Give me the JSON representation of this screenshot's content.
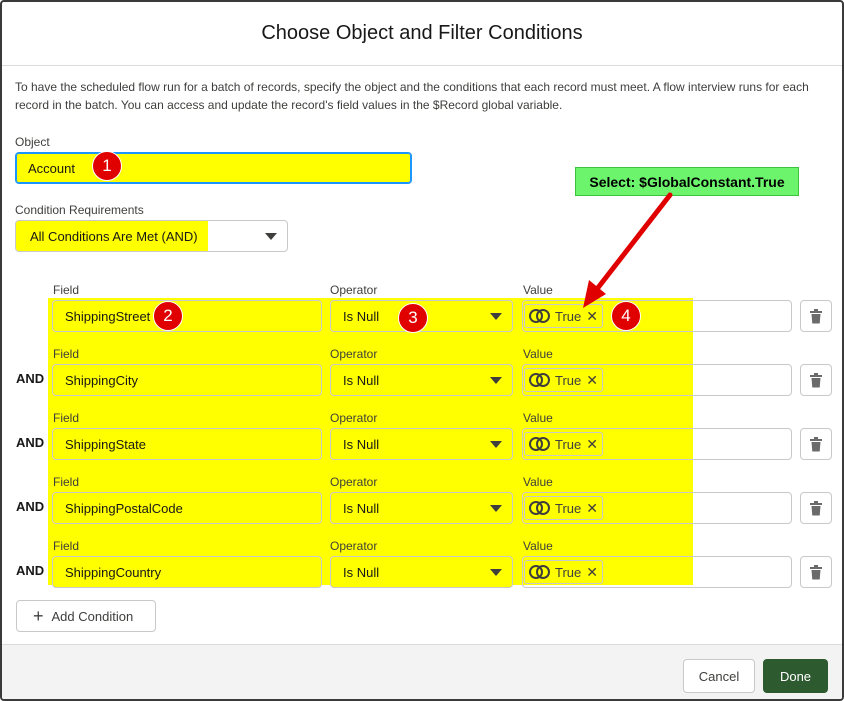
{
  "dialog": {
    "title": "Choose Object and Filter Conditions",
    "description": "To have the scheduled flow run for a batch of records, specify the object and the conditions that each record must meet. A flow interview runs for each record in the batch. You can access and update the record's field values in the $Record global variable."
  },
  "object": {
    "label": "Object",
    "value": "Account"
  },
  "requirements": {
    "label": "Condition Requirements",
    "value": "All Conditions Are Met (AND)"
  },
  "conditions": [
    {
      "connector": "",
      "field_label": "Field",
      "field": "ShippingStreet",
      "operator_label": "Operator",
      "operator": "Is Null",
      "value_label": "Value",
      "value": "True"
    },
    {
      "connector": "AND",
      "field_label": "Field",
      "field": "ShippingCity",
      "operator_label": "Operator",
      "operator": "Is Null",
      "value_label": "Value",
      "value": "True"
    },
    {
      "connector": "AND",
      "field_label": "Field",
      "field": "ShippingState",
      "operator_label": "Operator",
      "operator": "Is Null",
      "value_label": "Value",
      "value": "True"
    },
    {
      "connector": "AND",
      "field_label": "Field",
      "field": "ShippingPostalCode",
      "operator_label": "Operator",
      "operator": "Is Null",
      "value_label": "Value",
      "value": "True"
    },
    {
      "connector": "AND",
      "field_label": "Field",
      "field": "ShippingCountry",
      "operator_label": "Operator",
      "operator": "Is Null",
      "value_label": "Value",
      "value": "True"
    }
  ],
  "add_condition_label": "Add Condition",
  "footer": {
    "cancel_label": "Cancel",
    "done_label": "Done"
  },
  "annotations": {
    "badges": [
      "1",
      "2",
      "3",
      "4"
    ],
    "callout": "Select: $GlobalConstant.True",
    "highlight_color": "#ffff00",
    "badge_color": "#e00000",
    "callout_color": "#6cf46c",
    "arrow_color": "#e00000"
  },
  "colors": {
    "done_button": "#2e5a30",
    "focus_border": "#1b96ff"
  },
  "icons": {
    "value_pill": "global-constant-icon",
    "remove": "close-icon",
    "delete_row": "trash-icon",
    "add": "plus-icon",
    "dropdown": "chevron-down-icon"
  }
}
